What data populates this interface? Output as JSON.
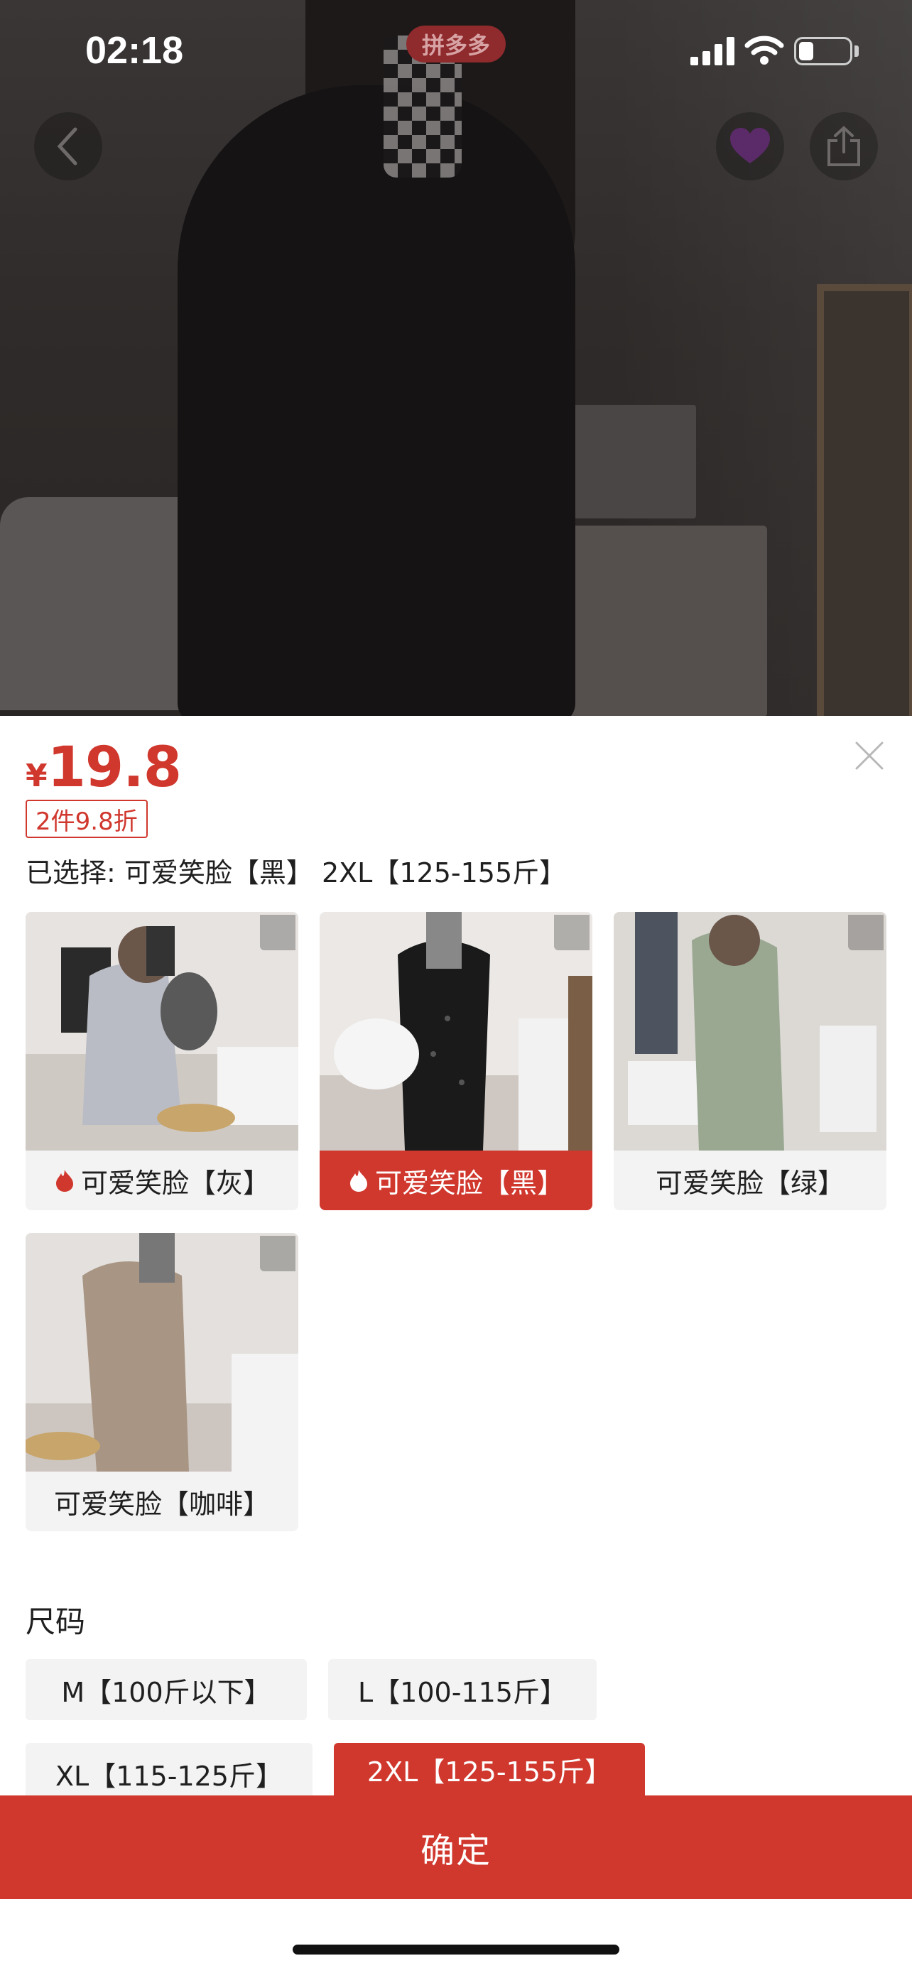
{
  "status_bar": {
    "time": "02:18"
  },
  "header": {
    "back_icon": "chevron-left-icon",
    "share_icon": "share-icon",
    "logo_text": "拼多多"
  },
  "product": {
    "currency": "¥",
    "price": "19.8",
    "discount_tag": "2件9.8折",
    "selected_text": "已选择: 可爱笑脸【黑】 2XL【125-155斤】"
  },
  "colors": [
    {
      "label": "可爱笑脸【灰】",
      "hot": true,
      "selected": false
    },
    {
      "label": "可爱笑脸【黑】",
      "hot": true,
      "selected": true
    },
    {
      "label": "可爱笑脸【绿】",
      "hot": false,
      "selected": false
    },
    {
      "label": "可爱笑脸【咖啡】",
      "hot": false,
      "selected": false
    }
  ],
  "size_section": {
    "title": "尺码",
    "options": [
      {
        "label": "M【100斤以下】",
        "selected": false
      },
      {
        "label": "L【100-115斤】",
        "selected": false
      },
      {
        "label": "XL【115-125斤】",
        "selected": false
      },
      {
        "label": "2XL【125-155斤】",
        "selected": true
      }
    ]
  },
  "confirm_label": "确定",
  "accent_color": "#d0372d"
}
